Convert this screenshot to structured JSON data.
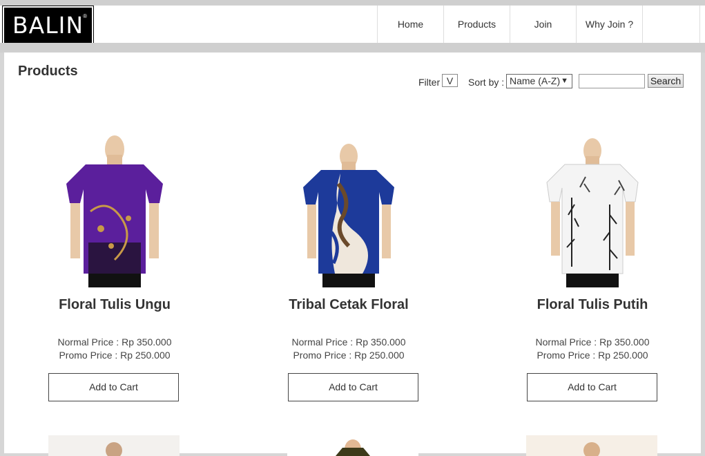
{
  "header": {
    "logo_text": "BALIN",
    "logo_mark": "®",
    "nav": [
      "Home",
      "Products",
      "Join",
      "Why Join ?"
    ]
  },
  "toolbar": {
    "page_title": "Products",
    "filter_label": "Filter",
    "filter_value": "V",
    "sort_label": "Sort by :",
    "sort_value": "Name (A-Z)",
    "search_value": "",
    "search_button": "Search"
  },
  "products": [
    {
      "name": "Floral Tulis Ungu",
      "normal_price": "Normal Price : Rp 350.000",
      "promo_price": "Promo Price : Rp 250.000",
      "cart_label": "Add to Cart",
      "shirt_color": "#5b1f9c",
      "accent_color": "#c89a48",
      "pattern_icon": "floral-pattern-icon"
    },
    {
      "name": "Tribal Cetak Floral",
      "normal_price": "Normal Price : Rp 350.000",
      "promo_price": "Promo Price : Rp 250.000",
      "cart_label": "Add to Cart",
      "shirt_color": "#1d3a9a",
      "accent_color": "#6b4a2b",
      "pattern_icon": "tribal-pattern-icon"
    },
    {
      "name": "Floral Tulis Putih",
      "normal_price": "Normal Price : Rp 350.000",
      "promo_price": "Promo Price : Rp 250.000",
      "cart_label": "Add to Cart",
      "shirt_color": "#f4f4f4",
      "accent_color": "#222222",
      "pattern_icon": "bamboo-pattern-icon"
    }
  ]
}
